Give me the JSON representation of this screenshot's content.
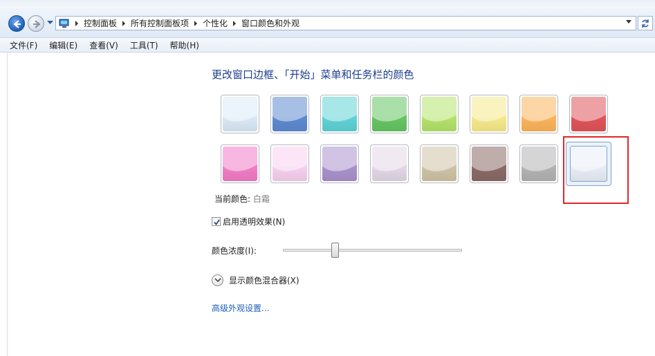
{
  "address_bar": {
    "breadcrumbs": [
      "控制面板",
      "所有控制面板项",
      "个性化",
      "窗口颜色和外观"
    ]
  },
  "menu": {
    "items": [
      "文件(F)",
      "编辑(E)",
      "查看(V)",
      "工具(T)",
      "帮助(H)"
    ]
  },
  "page": {
    "heading": "更改窗口边框、「开始」菜单和任务栏的颜色",
    "current_color_label": "当前颜色: ",
    "current_color_value": "白霜",
    "transparency_label": "启用透明效果(N)",
    "transparency_checked": true,
    "intensity_label": "颜色浓度(I):",
    "intensity_value": 0.29,
    "mixer_label": "显示颜色混合器(X)",
    "advanced_link": "高级外观设置..."
  },
  "colors": {
    "row1": [
      "#dbe9f8",
      "#5f8ad0",
      "#5fd3d6",
      "#66c563",
      "#b4e36a",
      "#f7e98a",
      "#fcb45b",
      "#e0545a"
    ],
    "row2": [
      "#f27dc6",
      "#f7d0ef",
      "#a992cc",
      "#e3d8e6",
      "#cfc3a6",
      "#8a6a66",
      "#b3b3b3",
      "#e9eef6"
    ],
    "selected_index": 15,
    "highlight": "#e0262a",
    "link": "#1a5eb5",
    "heading": "#1d3c8e"
  }
}
